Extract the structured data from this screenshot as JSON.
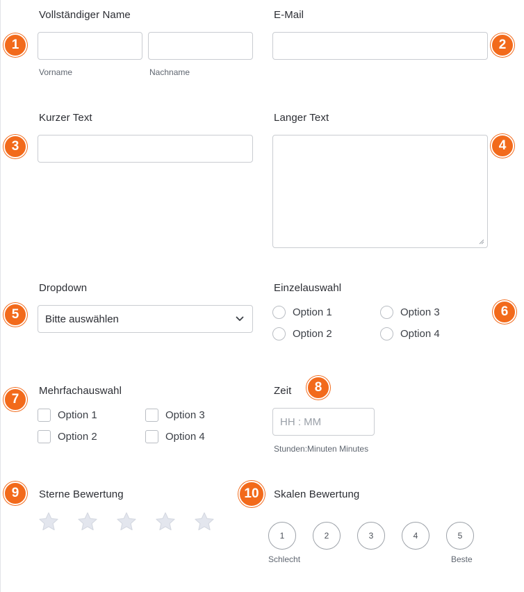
{
  "colors": {
    "accent": "#f26a1b",
    "border": "#c9ccd1",
    "star": "#e3e6ee"
  },
  "fields": {
    "full_name": {
      "label": "Vollständiger Name",
      "first_value": "",
      "last_value": "",
      "first_sub": "Vorname",
      "last_sub": "Nachname",
      "badge": "1"
    },
    "email": {
      "label": "E-Mail",
      "value": "",
      "badge": "2"
    },
    "short_text": {
      "label": "Kurzer Text",
      "value": "",
      "badge": "3"
    },
    "long_text": {
      "label": "Langer Text",
      "value": "",
      "badge": "4"
    },
    "dropdown": {
      "label": "Dropdown",
      "selected": "Bitte auswählen",
      "badge": "5",
      "icon": "chevron-down-icon"
    },
    "single_choice": {
      "label": "Einzelauswahl",
      "badge": "6",
      "options": [
        "Option 1",
        "Option 2",
        "Option 3",
        "Option 4"
      ]
    },
    "multi_choice": {
      "label": "Mehrfachauswahl",
      "badge": "7",
      "options": [
        "Option 1",
        "Option 2",
        "Option 3",
        "Option 4"
      ]
    },
    "time": {
      "label": "Zeit",
      "badge": "8",
      "placeholder": "HH : MM",
      "sub": "Stunden:Minuten Minutes"
    },
    "star_rating": {
      "label": "Sterne Bewertung",
      "badge": "9",
      "stars": 5,
      "value": 0
    },
    "scale_rating": {
      "label": "Skalen Bewertung",
      "badge": "10",
      "values": [
        "1",
        "2",
        "3",
        "4",
        "5"
      ],
      "low_label": "Schlecht",
      "high_label": "Beste"
    }
  }
}
